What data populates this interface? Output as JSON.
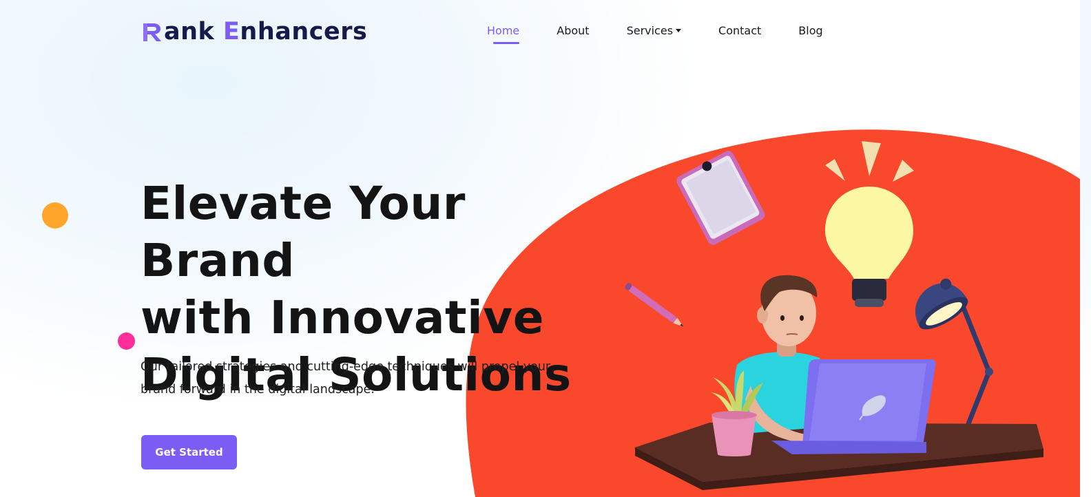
{
  "brand": {
    "logo_first": "ank ",
    "logo_accent": "E",
    "logo_rest": "nhancers",
    "accent_color": "#7b5cf5",
    "dark_color": "#161a4a"
  },
  "nav": {
    "items": [
      {
        "label": "Home",
        "active": true
      },
      {
        "label": "About"
      },
      {
        "label": "Services",
        "dropdown": true
      },
      {
        "label": "Contact"
      },
      {
        "label": "Blog"
      }
    ]
  },
  "hero": {
    "headline_line1": "Elevate Your Brand",
    "headline_line2": "with Innovative",
    "headline_line3": "Digital Solutions",
    "subtext": "Our tailored strategies and cutting-edge techniques will propel your brand forward in the digital landscape.",
    "cta_label": "Get Started",
    "blob_color": "#f9482b",
    "dot_colors": [
      "#ffa62b",
      "#ff2d9b"
    ]
  },
  "illustration": {
    "icons": [
      "notepad-icon",
      "lightbulb-icon",
      "pencil-icon",
      "desk-lamp-icon",
      "laptop-icon",
      "plant-icon",
      "person-icon",
      "desk-icon"
    ]
  }
}
